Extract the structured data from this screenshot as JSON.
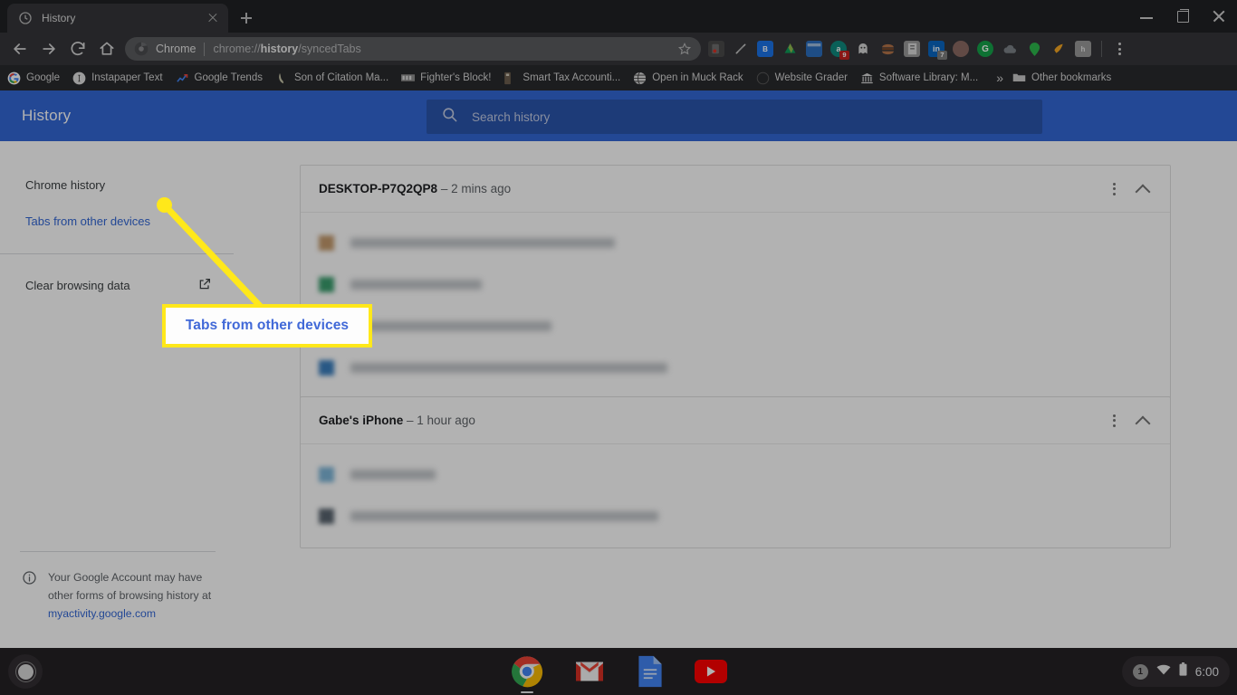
{
  "window": {
    "tab": {
      "title": "History",
      "favicon": "history-clock-icon"
    },
    "new_tab_label": "+",
    "controls": {
      "minimize": "Minimize",
      "maximize": "Maximize",
      "close": "Close"
    }
  },
  "toolbar": {
    "back_label": "Back",
    "forward_label": "Forward",
    "reload_label": "Reload",
    "home_label": "Home",
    "omnibox": {
      "site_label": "Chrome",
      "url_prefix": "chrome://",
      "url_bold": "history",
      "url_suffix": "/syncedTabs",
      "full_url": "chrome://history/syncedTabs",
      "bookmark_label": "Bookmark this tab"
    },
    "menu_label": "Customize and control Google Chrome",
    "extensions": [
      {
        "name": "extension-red-dot",
        "color": "#4d4d4d",
        "glyph": ""
      },
      {
        "name": "extension-instapaper",
        "color": "#3b3b3b",
        "glyph": ""
      },
      {
        "name": "extension-blue-box",
        "color": "#1a73e8",
        "glyph": ""
      },
      {
        "name": "extension-google-drive",
        "color": "#3b3b3b",
        "glyph": ""
      },
      {
        "name": "extension-window-blue",
        "color": "#2b6fbf",
        "glyph": ""
      },
      {
        "name": "extension-amazon-assistant",
        "color": "#0f8a7e",
        "glyph": "a",
        "badge": "9"
      },
      {
        "name": "extension-ghostery",
        "color": "#4a4a4a",
        "glyph": ""
      },
      {
        "name": "extension-hamburger-dark",
        "color": "#3a3030",
        "glyph": ""
      },
      {
        "name": "extension-clipboard",
        "color": "#8a8a8a",
        "glyph": ""
      },
      {
        "name": "extension-linkedin",
        "color": "#0a66c2",
        "glyph": "in",
        "badge": "7"
      },
      {
        "name": "extension-brown-circle",
        "color": "#8c6b63",
        "glyph": ""
      },
      {
        "name": "extension-grammarly",
        "color": "#15a34a",
        "glyph": "G"
      },
      {
        "name": "extension-cloud-gray",
        "color": "#7b8287",
        "glyph": ""
      },
      {
        "name": "extension-green-pin",
        "color": "#2db84c",
        "glyph": ""
      },
      {
        "name": "extension-honey",
        "color": "#f5a623",
        "glyph": ""
      },
      {
        "name": "extension-gray-tile",
        "color": "#9a9a9a",
        "glyph": ""
      }
    ]
  },
  "bookmarks_bar": {
    "items": [
      {
        "label": "Google",
        "icon": "google-g-icon",
        "color": "#ffffff"
      },
      {
        "label": "Instapaper Text",
        "icon": "instapaper-icon",
        "color": "#3f3f3f"
      },
      {
        "label": "Google Trends",
        "icon": "google-trends-icon",
        "color": "#2c2c2c"
      },
      {
        "label": "Son of Citation Ma...",
        "icon": "citation-machine-icon",
        "color": "#3a3a2a"
      },
      {
        "label": "Fighter's Block!",
        "icon": "fighters-block-icon",
        "color": "#6d6d6d"
      },
      {
        "label": "Smart Tax Accounti...",
        "icon": "smart-tax-icon",
        "color": "#4a4038"
      },
      {
        "label": "Open in Muck Rack",
        "icon": "muck-rack-icon",
        "color": "#3a3a3a"
      },
      {
        "label": "Website Grader",
        "icon": "website-grader-icon",
        "color": "#343434"
      },
      {
        "label": "Software Library: M...",
        "icon": "archive-library-icon",
        "color": "#3d3d3d"
      }
    ],
    "overflow_label": "»",
    "other_bookmarks_label": "Other bookmarks",
    "other_bookmarks_icon": "folder-icon"
  },
  "history_page": {
    "header": {
      "title": "History",
      "accent_color": "#3367d6"
    },
    "search": {
      "placeholder": "Search history",
      "icon": "search-icon",
      "value": ""
    },
    "sidebar": {
      "items": [
        {
          "label": "Chrome history",
          "name": "sidebar-item-chrome-history",
          "selected": false
        },
        {
          "label": "Tabs from other devices",
          "name": "sidebar-item-tabs-from-other-devices",
          "selected": true
        },
        {
          "label": "Clear browsing data",
          "name": "sidebar-item-clear-browsing-data",
          "selected": false,
          "icon": "external-link-icon"
        }
      ],
      "footnote": {
        "icon": "info-icon",
        "text_line1": "Your Google Account may have",
        "text_line2": "other forms of browsing history",
        "text_prefix3": "at ",
        "link": "myactivity.google.com"
      }
    },
    "devices": [
      {
        "name": "DESKTOP-P7Q2QP8",
        "separator": "–",
        "last_synced": "2 mins ago",
        "menu_icon": "more-vertical-icon",
        "collapse_icon": "chevron-up-icon",
        "tabs": [
          {
            "favicon_color": "#c49a6c",
            "title_width": 292,
            "blurred": true
          },
          {
            "favicon_color": "#3a9e6e",
            "title_width": 145,
            "blurred": true
          },
          {
            "favicon_color": "#b8b8b8",
            "title_width": 222,
            "blurred": true
          },
          {
            "favicon_color": "#3b7fbf",
            "title_width": 350,
            "blurred": true
          }
        ]
      },
      {
        "name": "Gabe's iPhone",
        "separator": "–",
        "last_synced": "1 hour ago",
        "menu_icon": "more-vertical-icon",
        "collapse_icon": "chevron-up-icon",
        "tabs": [
          {
            "favicon_color": "#7eb6d9",
            "title_width": 94,
            "blurred": true
          },
          {
            "favicon_color": "#5a6570",
            "title_width": 340,
            "blurred": true
          }
        ]
      }
    ]
  },
  "callout": {
    "text": "Tabs from other devices",
    "border_color": "#ffe81a",
    "text_color": "#4169d8",
    "pointer": "line-to-sidebar-item"
  },
  "shelf": {
    "launcher_label": "Launcher",
    "apps": [
      {
        "name": "chrome-app-icon",
        "label": "Chrome",
        "active": true
      },
      {
        "name": "gmail-app-icon",
        "label": "Gmail",
        "active": false
      },
      {
        "name": "google-docs-app-icon",
        "label": "Docs",
        "active": false
      },
      {
        "name": "youtube-app-icon",
        "label": "YouTube",
        "active": false
      }
    ],
    "tray": {
      "notification_count": "1",
      "wifi_icon": "wifi-icon",
      "battery_icon": "battery-icon",
      "time": "6:00"
    }
  }
}
